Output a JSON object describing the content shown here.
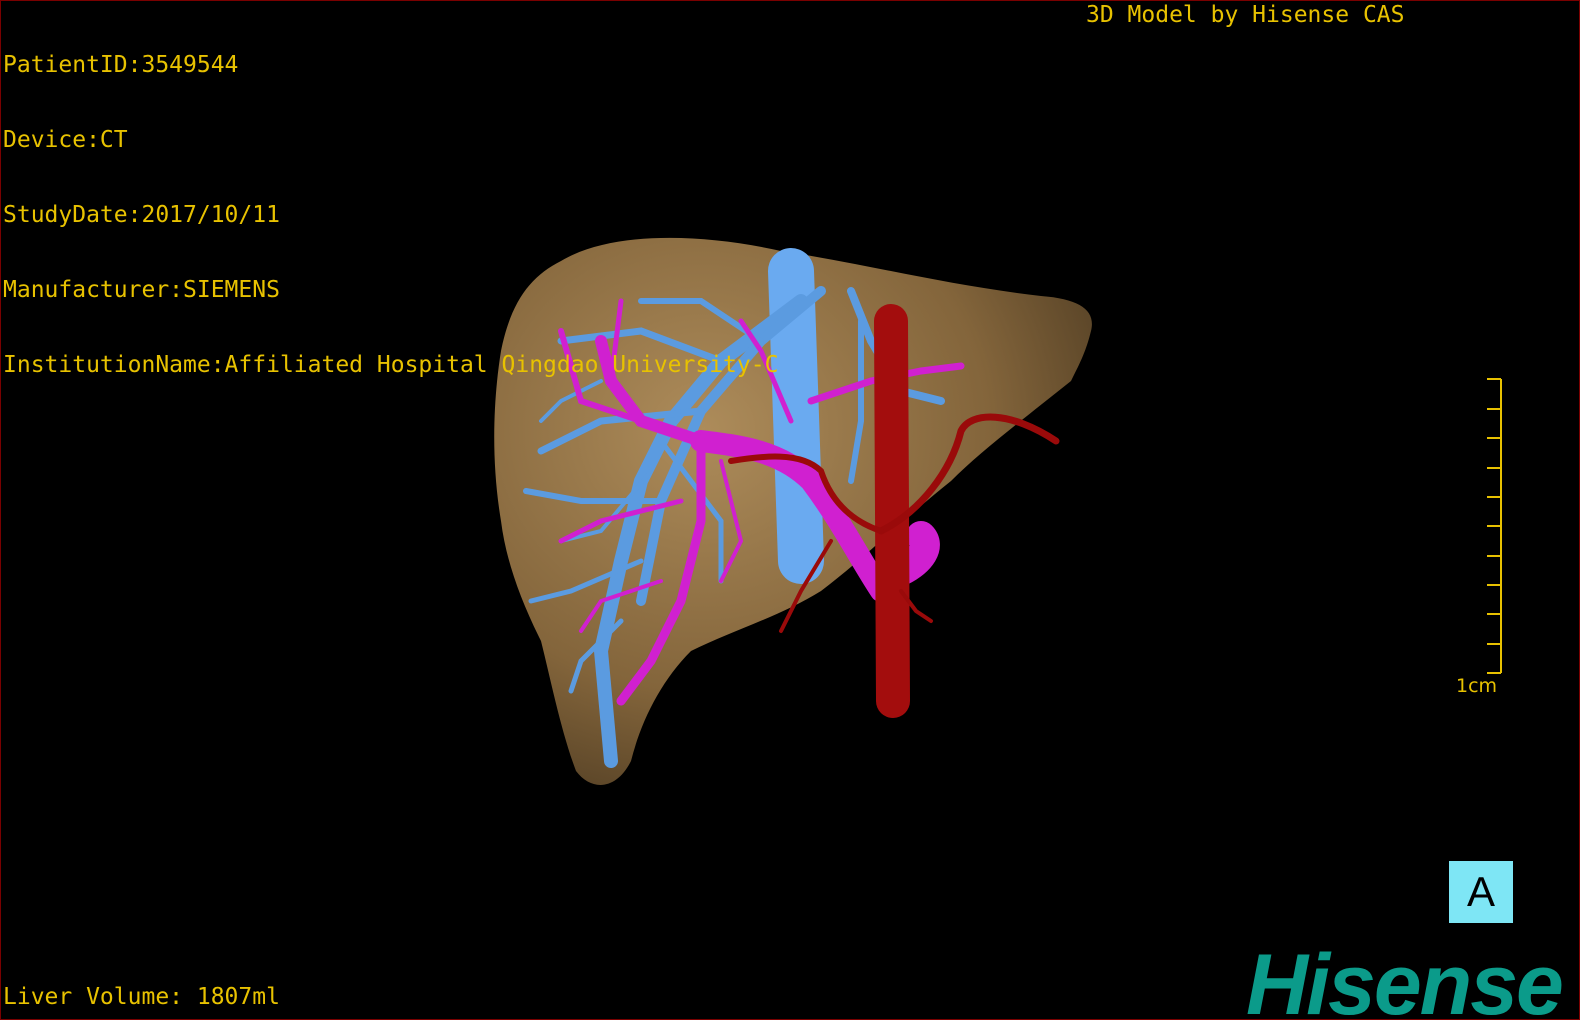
{
  "overlay": {
    "patient_id": "PatientID:3549544",
    "device": "Device:CT",
    "study_date": "StudyDate:2017/10/11",
    "manufacturer": "Manufacturer:SIEMENS",
    "institution": "InstitutionName:Affiliated Hospital Qingdao University-C",
    "model_credit": "3D Model by Hisense CAS",
    "liver_volume": "Liver Volume: 1807ml"
  },
  "scale_bar": {
    "label": "1cm"
  },
  "orientation": {
    "label": "A"
  },
  "brand": {
    "name": "Hisense"
  },
  "colors": {
    "overlay_text": "#e8c200",
    "liver": "#9c7a4a",
    "hepatic_vein": "#5b9be0",
    "portal_vein": "#d020d0",
    "artery": "#9a0a0a",
    "orientation_box": "#7ee6f5",
    "brand": "#0b9b8a"
  }
}
